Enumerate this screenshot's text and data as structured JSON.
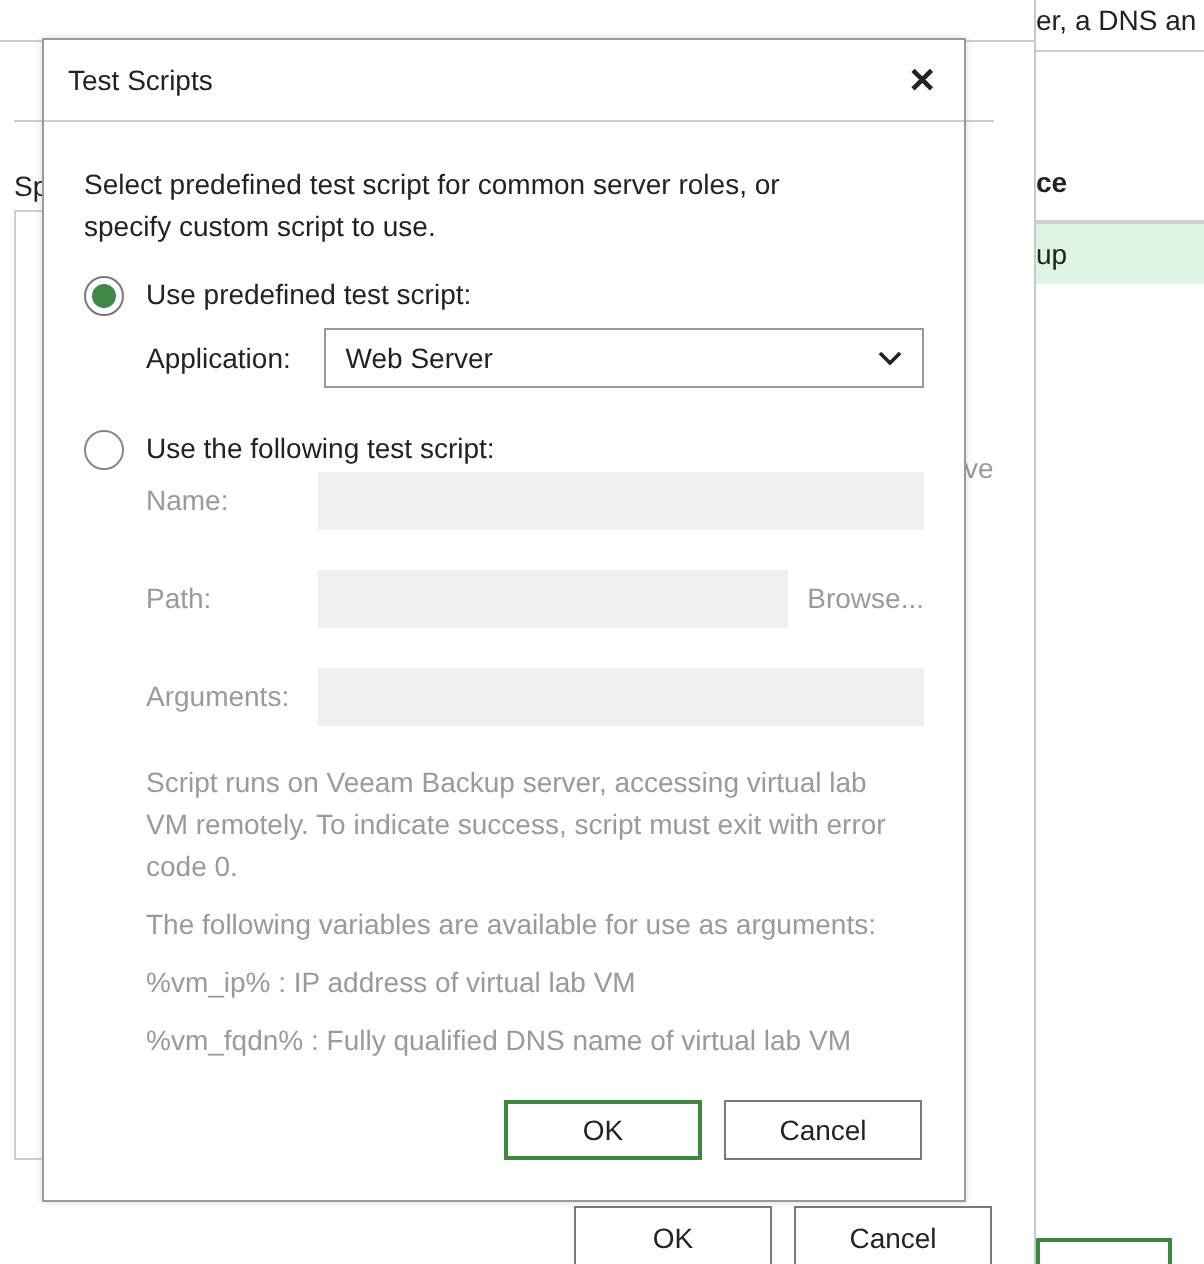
{
  "background": {
    "top_text": "er, a DNS an",
    "left_label": "Sp",
    "column_header": "ce",
    "selected_row": "up",
    "side_text": "ve",
    "buttons": [
      {
        "label": "OK"
      },
      {
        "label": "Cancel"
      }
    ]
  },
  "dialog": {
    "title": "Test Scripts",
    "close": "✕",
    "description": "Select predefined test script for common server roles, or specify custom script to use.",
    "options": [
      {
        "label": "Use predefined test script:",
        "selected": true
      },
      {
        "label": "Use the following test script:",
        "selected": false
      }
    ],
    "application": {
      "label": "Application:",
      "value": "Web Server"
    },
    "custom": {
      "disabled": true,
      "fields": [
        {
          "label": "Name:",
          "kind": "text"
        },
        {
          "label": "Path:",
          "kind": "browse",
          "button": "Browse..."
        },
        {
          "label": "Arguments:",
          "kind": "text"
        }
      ],
      "notes": [
        "Script runs on Veeam Backup server, accessing virtual lab VM remotely. To indicate success, script must exit with error code 0.",
        "The following variables are available for use as arguments:",
        "%vm_ip% : IP address of virtual lab VM",
        "%vm_fqdn% : Fully qualified DNS name of virtual lab VM"
      ]
    },
    "buttons": [
      {
        "label": "OK",
        "default": true
      },
      {
        "label": "Cancel",
        "default": false
      }
    ]
  }
}
